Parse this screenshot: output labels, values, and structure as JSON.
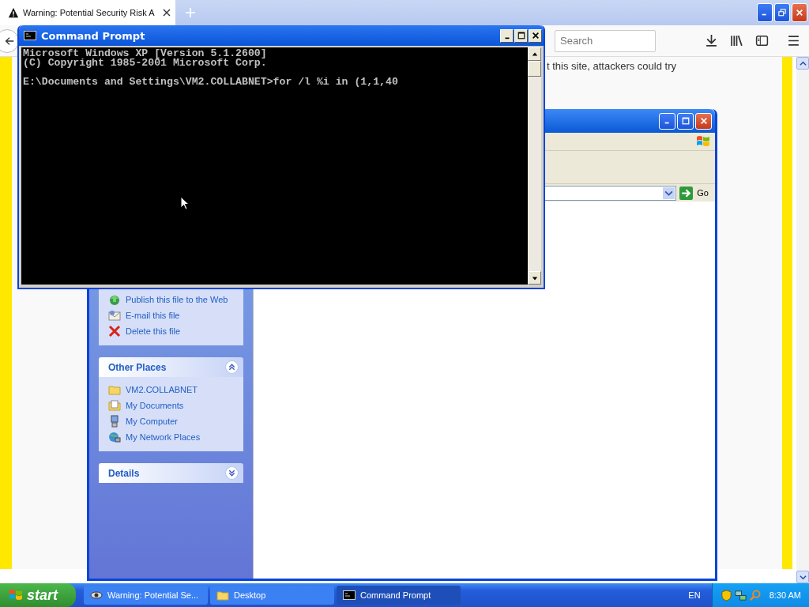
{
  "browser": {
    "tabs": [
      {
        "title": "Warning: Potential Security Risk A",
        "kind": "warning",
        "selected": true
      }
    ],
    "search": {
      "placeholder": "Search"
    },
    "page_text": "t this site, attackers could try"
  },
  "explorer": {
    "go_button": "Go",
    "task_panels": [
      {
        "items": [
          {
            "label": "Publish this file to the Web",
            "kind": "publish"
          },
          {
            "label": "E-mail this file",
            "kind": "email"
          },
          {
            "label": "Delete this file",
            "kind": "delete"
          }
        ]
      },
      {
        "title": "Other Places",
        "expanded": true,
        "items": [
          {
            "label": "VM2.COLLABNET",
            "kind": "folder"
          },
          {
            "label": "My Documents",
            "kind": "documents"
          },
          {
            "label": "My Computer",
            "kind": "computer"
          },
          {
            "label": "My Network Places",
            "kind": "network"
          }
        ]
      },
      {
        "title": "Details",
        "expanded": false
      }
    ]
  },
  "console": {
    "title": "Command Prompt",
    "header_lines": [
      "Microsoft Windows XP [Version 5.1.2600]",
      "(C) Copyright 1985-2001 Microsoft Corp."
    ],
    "command_line": "E:\\Documents and Settings\\VM2.COLLABNET>for /l %i in (1,1,40"
  },
  "taskbar": {
    "start": "start",
    "tasks": [
      {
        "label": "Warning: Potential Se...",
        "kind": "browser",
        "selected": false
      },
      {
        "label": "Desktop",
        "kind": "folder",
        "selected": false
      },
      {
        "label": "Command Prompt",
        "kind": "console",
        "selected": true
      }
    ],
    "language": "EN",
    "clock": "8:30 AM"
  }
}
